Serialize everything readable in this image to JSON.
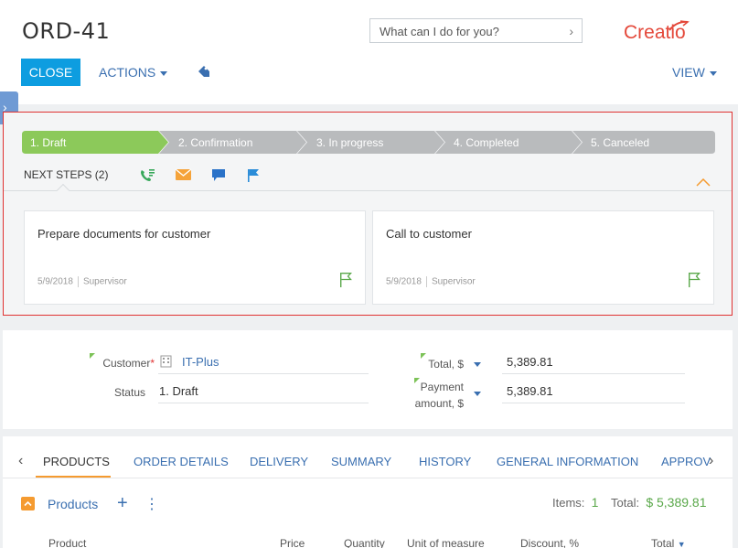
{
  "header": {
    "title": "ORD-41",
    "search_placeholder": "What can I do for you?",
    "logo_text": "Creatio",
    "close_label": "CLOSE",
    "actions_label": "ACTIONS",
    "view_label": "VIEW"
  },
  "stages": [
    {
      "label": "1. Draft",
      "active": true
    },
    {
      "label": "2. Confirmation",
      "active": false
    },
    {
      "label": "3. In progress",
      "active": false
    },
    {
      "label": "4. Completed",
      "active": false
    },
    {
      "label": "5. Canceled",
      "active": false
    }
  ],
  "next_steps": {
    "label": "NEXT STEPS (2)",
    "tasks": [
      {
        "title": "Prepare documents for customer",
        "date": "5/9/2018",
        "owner": "Supervisor"
      },
      {
        "title": "Call to customer",
        "date": "5/9/2018",
        "owner": "Supervisor"
      }
    ]
  },
  "fields": {
    "customer_label": "Customer",
    "customer_value": "IT-Plus",
    "status_label": "Status",
    "status_value": "1. Draft",
    "total_label": "Total, $",
    "total_value": "5,389.81",
    "payment_label_1": "Payment",
    "payment_label_2": "amount, $",
    "payment_value": "5,389.81"
  },
  "tabs": [
    "PRODUCTS",
    "ORDER DETAILS",
    "DELIVERY",
    "SUMMARY",
    "HISTORY",
    "GENERAL INFORMATION",
    "APPROV"
  ],
  "products": {
    "title": "Products",
    "items_label": "Items:",
    "items_count": "1",
    "total_label": "Total:",
    "total_value": "$ 5,389.81",
    "columns": [
      "Product",
      "Price",
      "Quantity",
      "Unit of measure",
      "Discount, %",
      "Total"
    ]
  },
  "colors": {
    "accent": "#0d9de0",
    "link": "#3a6fb0",
    "stage_active": "#8cc95a",
    "stage_inactive": "#b9bbbd",
    "highlight_border": "#e03232"
  }
}
